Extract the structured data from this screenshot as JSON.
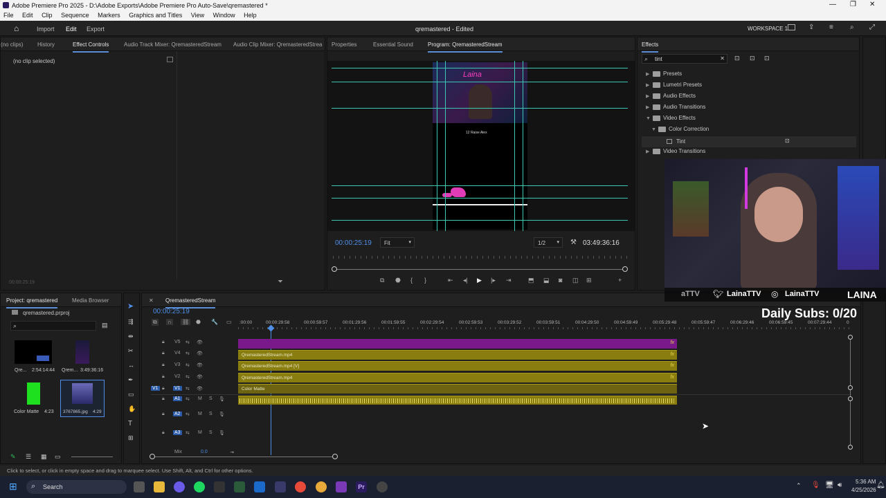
{
  "window": {
    "title": "Adobe Premiere Pro 2025 - D:\\Adobe Exports\\Adobe Premiere Pro Auto-Save\\qremastered *"
  },
  "menu": [
    "File",
    "Edit",
    "Clip",
    "Sequence",
    "Markers",
    "Graphics and Titles",
    "View",
    "Window",
    "Help"
  ],
  "appbar": {
    "import": "Import",
    "edit": "Edit",
    "export": "Export",
    "project_title": "qremastered - Edited",
    "workspace": "WORKSPACE 1"
  },
  "source_panel": {
    "tabs": [
      "(no clips)",
      "History",
      "Effect Controls",
      "Audio Track Mixer: QremasteredStream",
      "Audio Clip Mixer: QremasteredStrea"
    ],
    "no_clip": "(no clip selected)",
    "timecode": "00:00:25:19"
  },
  "program_panel": {
    "tabs": [
      "Properties",
      "Essential Sound",
      "Program: QremasteredStream"
    ],
    "timecode": "00:00:25:19",
    "fit": "Fit",
    "resolution": "1/2",
    "duration": "03:49:36:16",
    "preview_text_name": "Laina",
    "preview_text_caption": "12 Raise Alex"
  },
  "effects_panel": {
    "tab": "Effects",
    "search_value": "tint",
    "tree": [
      {
        "label": "Presets",
        "level": 0,
        "expanded": false
      },
      {
        "label": "Lumetri Presets",
        "level": 0,
        "expanded": false
      },
      {
        "label": "Audio Effects",
        "level": 0,
        "expanded": false
      },
      {
        "label": "Audio Transitions",
        "level": 0,
        "expanded": false
      },
      {
        "label": "Video Effects",
        "level": 0,
        "expanded": true
      },
      {
        "label": "Color Correction",
        "level": 1,
        "expanded": true
      },
      {
        "label": "Tint",
        "level": 2,
        "expanded": false
      },
      {
        "label": "Video Transitions",
        "level": 0,
        "expanded": false
      }
    ]
  },
  "project_panel": {
    "tabs": [
      "Project: qremastered",
      "Media Browser"
    ],
    "file": "qremastered.prproj",
    "items": [
      {
        "name": "Qre...",
        "duration": "2:54:14:44"
      },
      {
        "name": "Qrem...",
        "duration": "3:49:36:16"
      },
      {
        "name": "Color Matte",
        "duration": "4:23"
      },
      {
        "name": "3767865.jpg",
        "duration": "4:29"
      }
    ]
  },
  "timeline": {
    "sequence": "QremasteredStream",
    "timecode": "00:00:25:19",
    "ruler": [
      ":00:00",
      "00:00:29:58",
      "00:00:59:57",
      "00:01:29:56",
      "00:01:59:55",
      "00:02:29:54",
      "00:02:59:53",
      "00:03:29:52",
      "00:03:59:51",
      "00:04:29:50",
      "00:04:59:49",
      "00:05:29:48",
      "00:05:59:47",
      "00:06:29:46",
      "00:06:59:45",
      "00:07:29:44",
      "0"
    ],
    "video_tracks": [
      {
        "name": "V5",
        "clip": ""
      },
      {
        "name": "V4",
        "clip": "QremasteredStream.mp4"
      },
      {
        "name": "V3",
        "clip": "QremasteredStream.mp4 [V]"
      },
      {
        "name": "V2",
        "clip": "QremasteredStream.mp4"
      },
      {
        "name": "V1",
        "clip": "Color Matte"
      }
    ],
    "audio_tracks": [
      "A1",
      "A2",
      "A3"
    ],
    "mix_label": "Mix",
    "mix_value": "0.0",
    "track_ctrl": {
      "mute": "M",
      "solo": "S"
    }
  },
  "status_bar": "Click to select, or click in empty space and drag to marquee select. Use Shift, Alt, and Ctrl for other options.",
  "overlay": {
    "twitter": "LainaTTV",
    "instagram": "LainaTTV",
    "brand": "LAINA",
    "daily_subs": "Daily Subs: 0/20",
    "partial": "aTTV"
  },
  "taskbar": {
    "search": "Search",
    "time": "5:36 AM",
    "date": "4/25/2026",
    "app_icon_pr": "Pr"
  },
  "colors": {
    "accent": "#5b8fd8",
    "timecode": "#4f8fe8",
    "clip_yellow": "#8a7d10",
    "clip_purple": "#7a1a8a",
    "guide": "#3cc8b4"
  }
}
